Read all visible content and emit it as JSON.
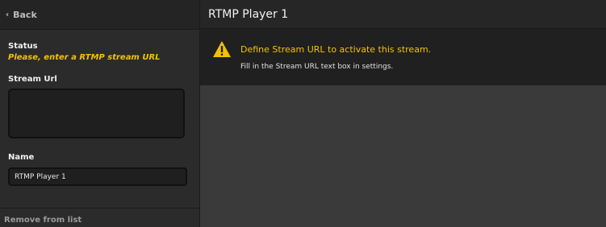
{
  "sidebar": {
    "back_label": "Back",
    "status_label": "Status",
    "status_text": "Please, enter a RTMP stream URL",
    "stream_url_label": "Stream Url",
    "stream_url_value": "",
    "name_label": "Name",
    "name_value": "RTMP Player 1",
    "remove_label": "Remove from list"
  },
  "main": {
    "title": "RTMP Player 1",
    "alert": {
      "icon": "warning-icon",
      "title": "Define Stream URL to activate this stream.",
      "subtitle": "Fill in the Stream URL text box in settings."
    }
  },
  "colors": {
    "accent": "#f2c200",
    "panel_dark": "#202020",
    "background": "#3a3a3a"
  }
}
